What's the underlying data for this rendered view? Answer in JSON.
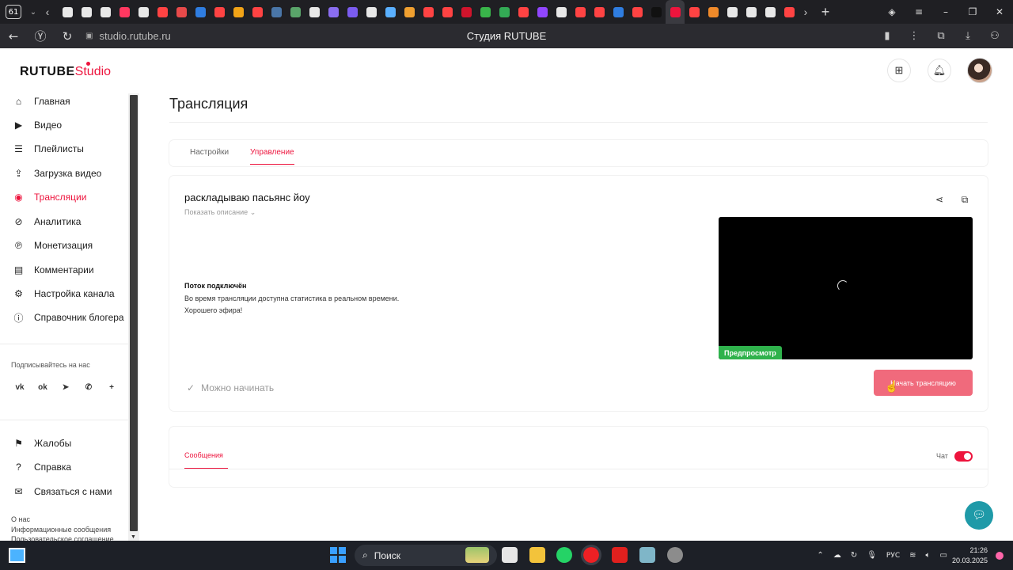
{
  "browser": {
    "tab_count": "61",
    "url": "studio.rutube.ru",
    "page_title": "Студия RUTUBE",
    "favicon_colors": [
      "#e8e8e8",
      "#e8e8e8",
      "#e8e8e8",
      "#ff3860",
      "#e8e8e8",
      "#ff4343",
      "#e84a4a",
      "#2f7de1",
      "#ff4343",
      "#f2a417",
      "#ff4343",
      "#4a76a8",
      "#5aa56a",
      "#e8e8e8",
      "#8a6df0",
      "#7b5cf0",
      "#e8e8e8",
      "#5ab0ff",
      "#f0a030",
      "#ff4343",
      "#ff4343",
      "#d0142c",
      "#39b54a",
      "#33aa55",
      "#ff4343",
      "#9146ff",
      "#e8e8e8",
      "#ff4343",
      "#ff4343",
      "#2f7de1",
      "#ff4343",
      "#111111",
      "#ed143d",
      "#ff4343",
      "#f08a2a",
      "#e8e8e8",
      "#e8e8e8",
      "#e8e8e8",
      "#ff4343"
    ]
  },
  "app": {
    "logo_main": "RUTUBE",
    "logo_studio": "Studio",
    "header_icons": [
      "add-video-icon",
      "bell-icon"
    ]
  },
  "sidebar": {
    "items": [
      {
        "label": "Главная",
        "icon": "home-icon"
      },
      {
        "label": "Видео",
        "icon": "video-icon"
      },
      {
        "label": "Плейлисты",
        "icon": "playlist-icon"
      },
      {
        "label": "Загрузка видео",
        "icon": "upload-icon"
      },
      {
        "label": "Трансляции",
        "icon": "broadcast-icon"
      },
      {
        "label": "Аналитика",
        "icon": "analytics-icon"
      },
      {
        "label": "Монетизация",
        "icon": "monetization-icon"
      },
      {
        "label": "Комментарии",
        "icon": "comments-icon"
      },
      {
        "label": "Настройка канала",
        "icon": "gear-icon"
      },
      {
        "label": "Справочник блогера",
        "icon": "info-icon"
      }
    ],
    "follow_label": "Подписывайтесь на нас",
    "socials": [
      "vk-icon",
      "ok-icon",
      "telegram-icon",
      "viber-icon",
      "plus-icon"
    ],
    "bottom_items": [
      {
        "label": "Жалобы",
        "icon": "flag-icon"
      },
      {
        "label": "Справка",
        "icon": "help-icon"
      },
      {
        "label": "Связаться с нами",
        "icon": "mail-icon"
      }
    ],
    "footer_links": [
      "О нас",
      "Информационные сообщения",
      "Пользовательское соглашение"
    ]
  },
  "main": {
    "title": "Трансляция",
    "tabs": [
      {
        "label": "Настройки",
        "active": false
      },
      {
        "label": "Управление",
        "active": true
      }
    ],
    "stream": {
      "title": "раскладываю пасьянс йоу",
      "show_description": "Показать описание",
      "status_head": "Поток подключён",
      "status_lines": [
        "Во время трансляции доступна статистика в реальном времени.",
        "Хорошего эфира!"
      ],
      "ready_text": "Можно начинать",
      "preview_badge": "Предпросмотр",
      "start_button": "Начать трансляцию"
    },
    "chat": {
      "messages_tab": "Сообщения",
      "chat_label": "Чат",
      "chat_enabled": true
    }
  },
  "taskbar": {
    "search_label": "Поиск",
    "lang": "РУС",
    "time": "21:26",
    "date": "20.03.2025"
  },
  "colors": {
    "accent": "#ed143d",
    "start_button": "#f06a7c",
    "preview_badge": "#2fb24c",
    "support_fab": "#1f9aa8"
  }
}
